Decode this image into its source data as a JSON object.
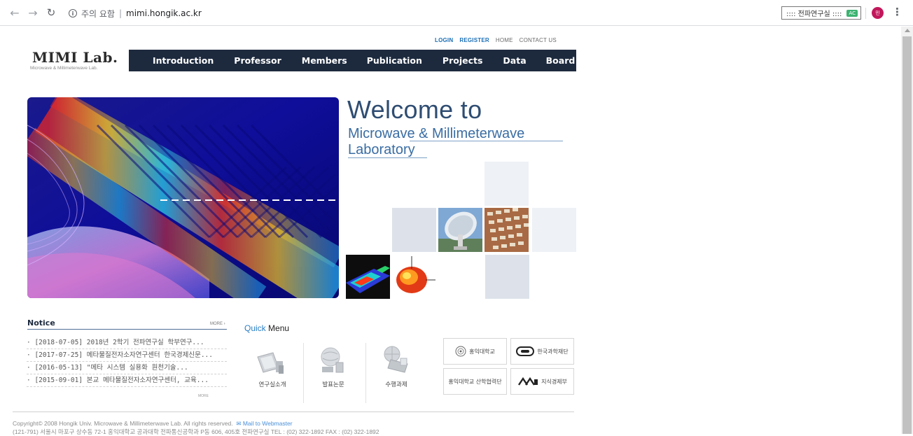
{
  "browser": {
    "security_label": "주의 요함",
    "url": "mimi.hongik.ac.kr",
    "extension_label": ":::: 전파연구실 ::::",
    "extension_badge": "AC",
    "profile_initial": "민"
  },
  "header": {
    "top_links": [
      "LOGIN",
      "REGISTER",
      "HOME",
      "CONTACT US"
    ],
    "logo": "MIMI Lab.",
    "logo_sub": "Microwave & Millimeterwave Lab.",
    "nav": [
      "Introduction",
      "Professor",
      "Members",
      "Publication",
      "Projects",
      "Data",
      "Board"
    ]
  },
  "hero": {
    "welcome": "Welcome to",
    "line1": "Microwave & Millimeterwave",
    "line2": "Laboratory"
  },
  "notice": {
    "title": "Notice",
    "more": "MORE ›",
    "items": [
      "· [2018-07-05] 2018년 2학기 전파연구실 학부연구...",
      "· [2017-07-25] 메타물질전자소자연구센터 한국경제신문...",
      "· [2016-05-13] \"메타 시스템 실용화 원천기술...",
      "· [2015-09-01] 본교 메타물질전자소자연구센터, 교육..."
    ],
    "tail": "MORE"
  },
  "quick_menu": {
    "title_colored": "Quick",
    "title_plain": "Menu",
    "items": [
      {
        "label": "연구실소개",
        "icon": "lab-intro-icon"
      },
      {
        "label": "발표논문",
        "icon": "papers-icon"
      },
      {
        "label": "수행과제",
        "icon": "projects-icon"
      }
    ]
  },
  "partners": [
    {
      "label": "홍익대학교",
      "icon": "hongik-seal-icon"
    },
    {
      "label": "한국과학재단",
      "icon": "kosef-logo-icon"
    },
    {
      "label": "홍익대학교 산학협력단",
      "icon": ""
    },
    {
      "label": "지식경제부",
      "icon": "mke-logo-icon"
    }
  ],
  "footer": {
    "copyright": "Copyright© 2008 Hongik Univ. Microwave & Millimeterwave Lab. All rights reserved.",
    "mail": "Mail to Webmaster",
    "address": "(121-791) 서울시 마포구 상수동 72-1 홍익대학교 공과대학 전파통신공학과 P동 606, 405호 전파연구실 TEL : (02) 322-1892 FAX : (02) 322-1892"
  },
  "colors": {
    "nav_bg": "#1d2a3e",
    "accent_blue": "#2a7fc4",
    "welcome_text": "#2f4d72"
  }
}
